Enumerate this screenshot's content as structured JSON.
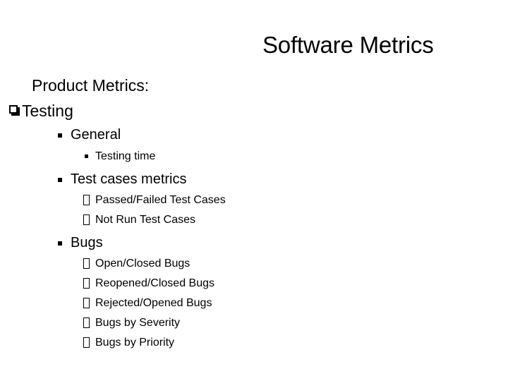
{
  "slide": {
    "title": "Software Metrics",
    "background_color": "#ffffff",
    "text_color": "#000000"
  },
  "body": {
    "heading": "Product Metrics:",
    "outline": [
      {
        "level": 1,
        "bullet": "hollow-shadow-square-bullet",
        "text": "Testing"
      },
      {
        "level": 2,
        "bullet": "filled-square-bullet",
        "text": "General"
      },
      {
        "level": 3,
        "bullet": "small-filled-square-bullet",
        "text": "Testing time"
      },
      {
        "level": 2,
        "bullet": "filled-square-bullet",
        "text": "Test cases metrics"
      },
      {
        "level": 3,
        "bullet": "hollow-box-bullet",
        "text": "Passed/Failed Test Cases"
      },
      {
        "level": 3,
        "bullet": "hollow-box-bullet",
        "text": "Not Run Test Cases"
      },
      {
        "level": 2,
        "bullet": "filled-square-bullet",
        "text": "Bugs"
      },
      {
        "level": 3,
        "bullet": "hollow-box-bullet",
        "text": "Open/Closed Bugs"
      },
      {
        "level": 3,
        "bullet": "hollow-box-bullet",
        "text": "Reopened/Closed Bugs"
      },
      {
        "level": 3,
        "bullet": "hollow-box-bullet",
        "text": "Rejected/Opened Bugs"
      },
      {
        "level": 3,
        "bullet": "hollow-box-bullet",
        "text": "Bugs by Severity"
      },
      {
        "level": 3,
        "bullet": "hollow-box-bullet",
        "text": "Bugs by Priority"
      }
    ]
  }
}
